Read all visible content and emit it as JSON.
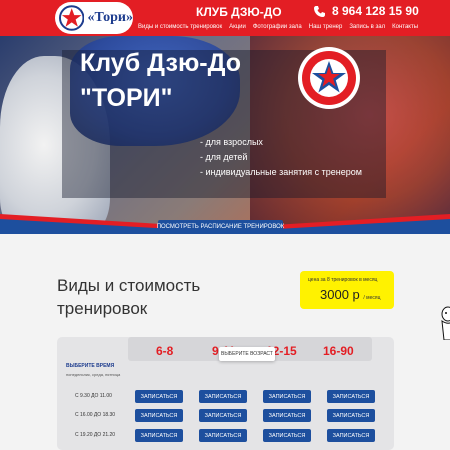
{
  "header": {
    "logo_text": "«Тори»",
    "title": "КЛУБ ДЗЮ-ДО",
    "phone": "8 964 128 15 90",
    "nav": [
      "Виды и стоимость тренировок",
      "Акции",
      "Фотографии зала",
      "Наш тренер",
      "Запись в зал",
      "Контакты"
    ]
  },
  "hero": {
    "title_line1": "Клуб Дзю-До",
    "title_line2": "\"ТОРИ\"",
    "items": [
      "- для взрослых",
      "- для детей",
      "- индивидуальные занятия с тренером"
    ],
    "button": "ПОСМОТРЕТЬ РАСПИСАНИЕ ТРЕНИРОВОК"
  },
  "pricing": {
    "title_line1": "Виды и стоимость",
    "title_line2": "тренировок",
    "badge_caption": "цена за 8 тренировок в месяц",
    "badge_price": "3000 р",
    "badge_unit": "/ месяц"
  },
  "schedule": {
    "ages": [
      "6-8",
      "9-11",
      "12-15",
      "16-90"
    ],
    "age_tooltip": "ВЫБЕРИТЕ ВОЗРАСТ",
    "time_header": "ВЫБЕРИТЕ ВРЕМЯ",
    "time_sub": "понедельник, среда, пятница",
    "times": [
      "С 9.30 ДО 11.00",
      "С 16.00 ДО 18.30",
      "С 19.20 ДО 21.20"
    ],
    "button_label": "ЗАПИСАТЬСЯ"
  },
  "colors": {
    "brand_red": "#e31e24",
    "brand_blue": "#1d4f9e",
    "badge_yellow": "#fff200"
  }
}
